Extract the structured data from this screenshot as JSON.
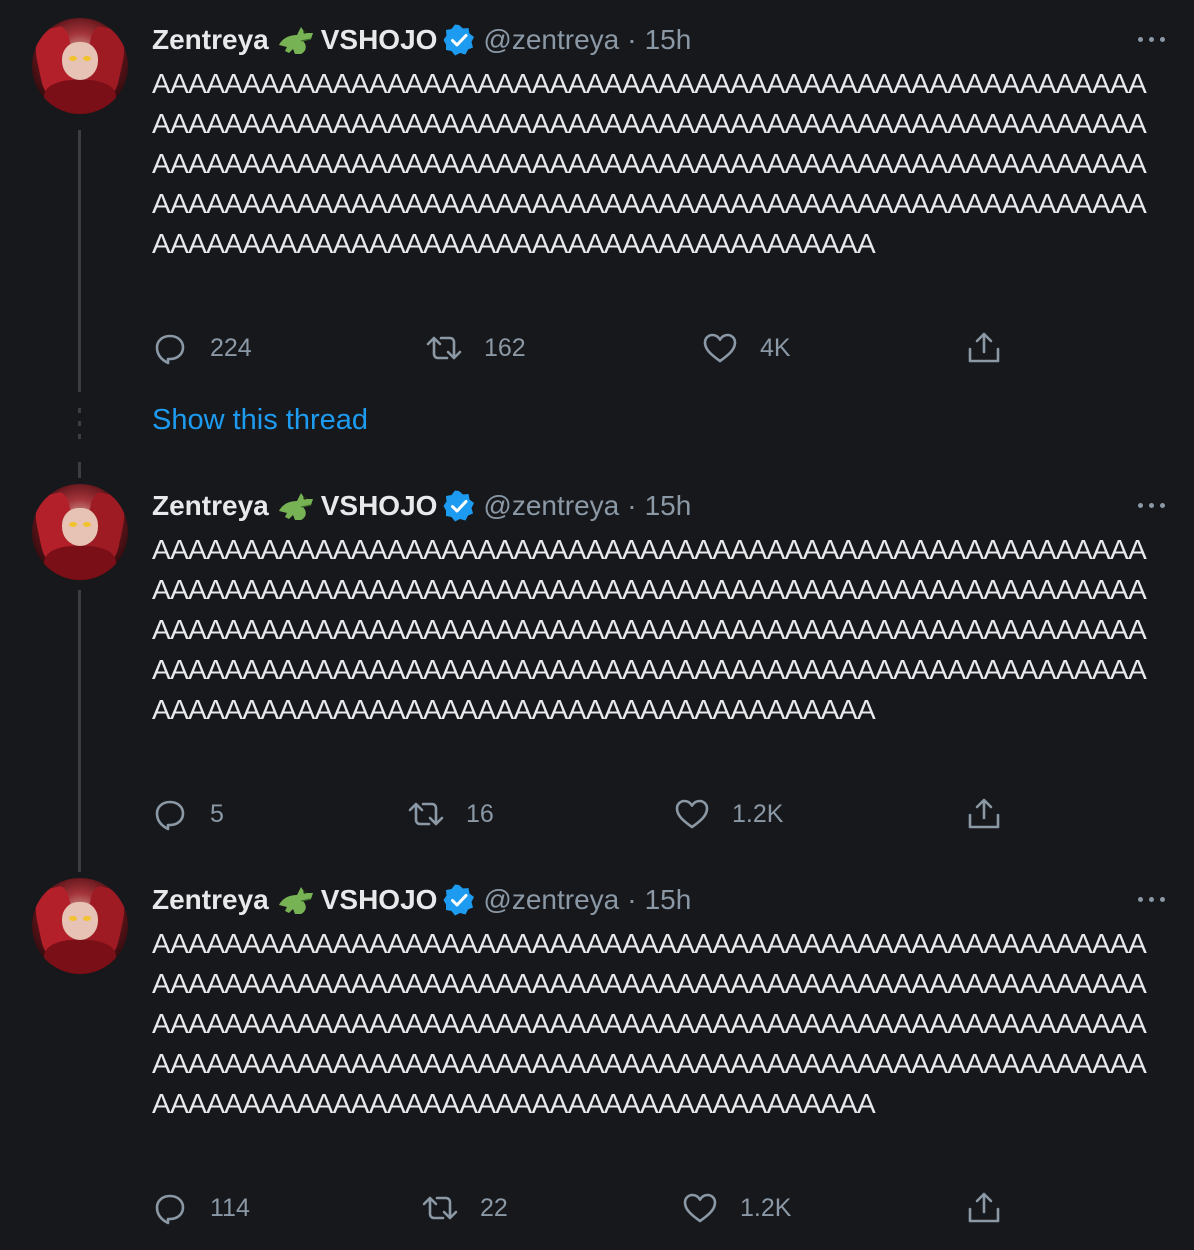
{
  "thread_link": "Show this thread",
  "tweets": [
    {
      "name": "Zentreya",
      "org": "VSHOJO",
      "handle": "@zentreya",
      "separator": "·",
      "time": "15h",
      "text": "AAAAAAAAAAAAAAAAAAAAAAAAAAAAAAAAAAAAAAAAAAAAAAAAAAAAAAAAAAAAAAAAAAAAAAAAAAAAAAAAAAAAAAAAAAAAAAAAAAAAAAAAAAAAAAAAAAAAAAAAAAAAAAAAAAAAAAAAAAAAAAAAAAAAAAAAAAAAAAAAAAAAAAAAAAAAAAAAAAAAAAAAAAAAAAAAAAAAAAAAAAAAAAAAAAAAAAAAAAAAAAAAAAAAAAAAAAAAAAAAAAAAAAAAAAAAAAAAAAAA",
      "replies": "224",
      "retweets": "162",
      "likes": "4K"
    },
    {
      "name": "Zentreya",
      "org": "VSHOJO",
      "handle": "@zentreya",
      "separator": "·",
      "time": "15h",
      "text": "AAAAAAAAAAAAAAAAAAAAAAAAAAAAAAAAAAAAAAAAAAAAAAAAAAAAAAAAAAAAAAAAAAAAAAAAAAAAAAAAAAAAAAAAAAAAAAAAAAAAAAAAAAAAAAAAAAAAAAAAAAAAAAAAAAAAAAAAAAAAAAAAAAAAAAAAAAAAAAAAAAAAAAAAAAAAAAAAAAAAAAAAAAAAAAAAAAAAAAAAAAAAAAAAAAAAAAAAAAAAAAAAAAAAAAAAAAAAAAAAAAAAAAAAAAAAAAAAAAAA",
      "replies": "5",
      "retweets": "16",
      "likes": "1.2K"
    },
    {
      "name": "Zentreya",
      "org": "VSHOJO",
      "handle": "@zentreya",
      "separator": "·",
      "time": "15h",
      "text": "AAAAAAAAAAAAAAAAAAAAAAAAAAAAAAAAAAAAAAAAAAAAAAAAAAAAAAAAAAAAAAAAAAAAAAAAAAAAAAAAAAAAAAAAAAAAAAAAAAAAAAAAAAAAAAAAAAAAAAAAAAAAAAAAAAAAAAAAAAAAAAAAAAAAAAAAAAAAAAAAAAAAAAAAAAAAAAAAAAAAAAAAAAAAAAAAAAAAAAAAAAAAAAAAAAAAAAAAAAAAAAAAAAAAAAAAAAAAAAAAAAAAAAAAAAAAAAAAAAAA",
      "replies": "114",
      "retweets": "22",
      "likes": "1.2K"
    }
  ],
  "icons": {
    "reply": "reply-icon",
    "retweet": "retweet-icon",
    "like": "like-icon",
    "share": "share-icon",
    "more": "more-icon",
    "verified": "verified-badge-icon",
    "org_emoji": "crocodile-icon"
  },
  "colors": {
    "background": "#17181c",
    "text": "#e7e9ea",
    "muted": "#8b98a5",
    "link": "#1d9bf0",
    "verified": "#1d9bf0",
    "thread_line": "#3a3d42"
  }
}
